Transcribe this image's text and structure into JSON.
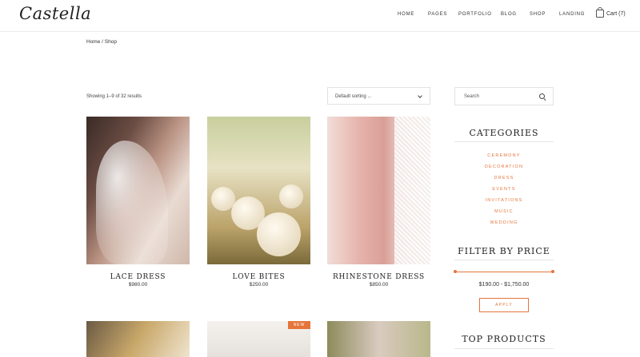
{
  "header": {
    "logo": "Castella",
    "nav": [
      "HOME",
      "PAGES",
      "PORTFOLIO",
      "BLOG",
      "SHOP",
      "LANDING"
    ],
    "cart_label": "Cart (7)"
  },
  "breadcrumb": "Home / Shop",
  "toolbar": {
    "result_count": "Showing 1–9 of 32 results",
    "sort_value": "Default sorting ..."
  },
  "products": [
    {
      "name": "LACE DRESS",
      "price": "$980.00"
    },
    {
      "name": "LOVE BITES",
      "price": "$250.00"
    },
    {
      "name": "RHINESTONE DRESS",
      "price": "$850.00"
    }
  ],
  "bottom_products": {
    "badge": "NEW"
  },
  "sidebar": {
    "search_placeholder": "Search",
    "categories_title": "CATEGORIES",
    "categories": [
      "CEREMONY",
      "DECORATION",
      "DRESS",
      "EVENTS",
      "INVITATIONS",
      "MUSIC",
      "WEDDING"
    ],
    "price_title": "FILTER BY PRICE",
    "price_range": "$190.00 - $1,750.00",
    "apply_label": "APPLY",
    "top_products_title": "TOP PRODUCTS"
  },
  "colors": {
    "accent": "#e4753b"
  }
}
